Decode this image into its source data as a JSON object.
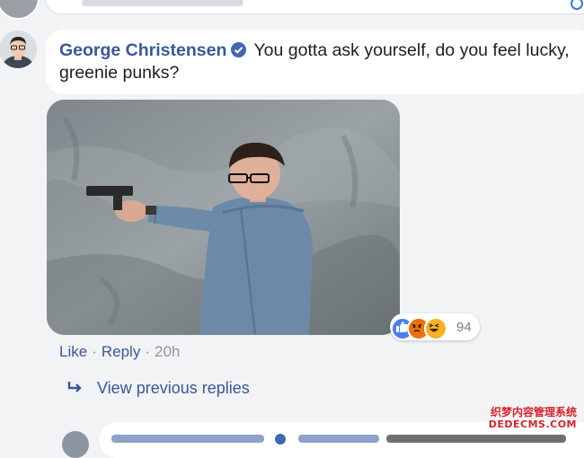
{
  "post": {
    "author": "George Christensen",
    "text": "You gotta ask yourself, do you feel lucky, greenie punks?",
    "reactions": {
      "types": [
        "like-icon",
        "angry-icon",
        "haha-icon"
      ],
      "count": "94"
    },
    "actions": {
      "like": "Like",
      "reply": "Reply",
      "time": "20h",
      "separator": "·"
    }
  },
  "replies": {
    "view_previous": "View previous replies"
  },
  "watermark": {
    "line1": "织梦内容管理系统",
    "line2": "DEDECMS.COM"
  },
  "colors": {
    "author_link": "#385898",
    "meta_text": "#90949c",
    "bubble": "#ffffff",
    "background": "#f2f3f5"
  }
}
